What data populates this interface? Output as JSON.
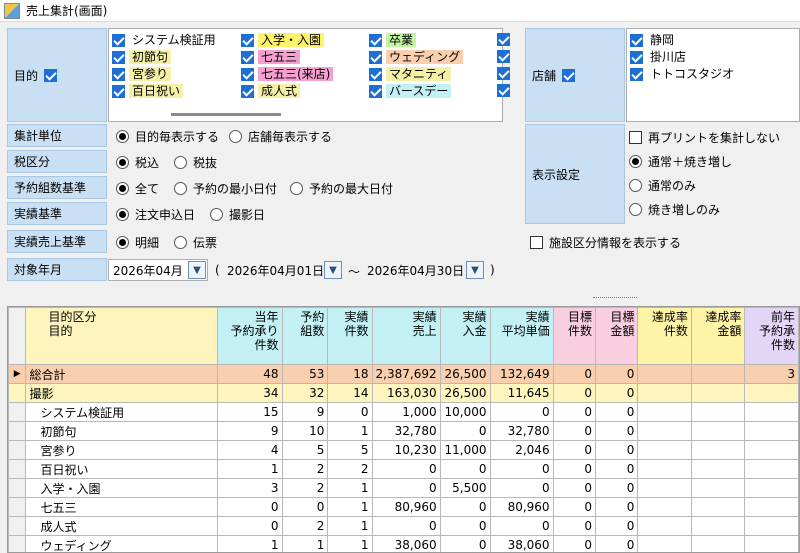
{
  "window": {
    "title": "売上集計(画面)"
  },
  "purpose": {
    "label": "目的",
    "items": [
      {
        "label": "システム検証用",
        "color": "#ffffff"
      },
      {
        "label": "初節句",
        "color": "#f5f0a8"
      },
      {
        "label": "宮参り",
        "color": "#f5f0a8"
      },
      {
        "label": "百日祝い",
        "color": "#f5f0a8"
      },
      {
        "label": "入学・入園",
        "color": "#fff36a"
      },
      {
        "label": "七五三",
        "color": "#f5a0d0"
      },
      {
        "label": "七五三(来店)",
        "color": "#f5a0d0"
      },
      {
        "label": "成人式",
        "color": "#f5f0a8"
      },
      {
        "label": "卒業",
        "color": "#c4f5a0"
      },
      {
        "label": "ウェディング",
        "color": "#f9cfae"
      },
      {
        "label": "マタニティ",
        "color": "#f5f0a8"
      },
      {
        "label": "バースデー",
        "color": "#c2f0f5"
      }
    ]
  },
  "store": {
    "label": "店舗",
    "items": [
      "静岡",
      "掛川店",
      "トトコスタジオ"
    ]
  },
  "agg_unit": {
    "label": "集計単位",
    "options": [
      "目的毎表示する",
      "店舗毎表示する"
    ]
  },
  "tax": {
    "label": "税区分",
    "options": [
      "税込",
      "税抜"
    ]
  },
  "booking_basis": {
    "label": "予約組数基準",
    "options": [
      "全て",
      "予約の最小日付",
      "予約の最大日付"
    ]
  },
  "actual_basis": {
    "label": "実績基準",
    "options": [
      "注文申込日",
      "撮影日"
    ]
  },
  "sales_basis": {
    "label": "実績売上基準",
    "options": [
      "明細",
      "伝票"
    ]
  },
  "target_month": {
    "label": "対象年月",
    "month": "2026年04月",
    "open": "(",
    "from": "2026年04月01日",
    "tilde": "～",
    "to": "2026年04月30日",
    "close": ")"
  },
  "display": {
    "label": "表示設定",
    "reprint": "再プリントを集計しない",
    "opt_all": "通常＋焼き増し",
    "opt_normal": "通常のみ",
    "opt_reprint": "焼き増しのみ",
    "facility": "施設区分情報を表示する"
  },
  "grid": {
    "header_left": [
      "目的区分",
      "目的"
    ],
    "columns": [
      [
        "当年",
        "予約承り",
        "件数"
      ],
      [
        "予約",
        "組数"
      ],
      [
        "実績",
        "件数"
      ],
      [
        "実績",
        "売上"
      ],
      [
        "実績",
        "入金"
      ],
      [
        "実績",
        "平均単価"
      ],
      [
        "目標",
        "件数"
      ],
      [
        "目標",
        "金額"
      ],
      [
        "達成率",
        "件数"
      ],
      [
        "達成率",
        "金額"
      ],
      [
        "前年",
        "予約承",
        "件数"
      ]
    ],
    "header_colors": [
      "#c2f0f5",
      "#c2f0f5",
      "#c2f0f5",
      "#c2f0f5",
      "#c2f0f5",
      "#c2f0f5",
      "#f9cfe0",
      "#f9cfe0",
      "#fff3a8",
      "#fff3a8",
      "#e2d5f5"
    ],
    "rows": [
      {
        "name": "総合計",
        "type": "total",
        "values": [
          "48",
          "53",
          "18",
          "2,387,692",
          "26,500",
          "132,649",
          "0",
          "0",
          "",
          "",
          "3"
        ]
      },
      {
        "name": "撮影",
        "type": "sub",
        "values": [
          "34",
          "32",
          "14",
          "163,030",
          "26,500",
          "11,645",
          "0",
          "0",
          "",
          "",
          ""
        ]
      },
      {
        "name": "システム検証用",
        "type": "item",
        "values": [
          "15",
          "9",
          "0",
          "1,000",
          "10,000",
          "0",
          "0",
          "0",
          "",
          "",
          ""
        ]
      },
      {
        "name": "初節句",
        "type": "item",
        "values": [
          "9",
          "10",
          "1",
          "32,780",
          "0",
          "32,780",
          "0",
          "0",
          "",
          "",
          ""
        ]
      },
      {
        "name": "宮参り",
        "type": "item",
        "values": [
          "4",
          "5",
          "5",
          "10,230",
          "11,000",
          "2,046",
          "0",
          "0",
          "",
          "",
          ""
        ]
      },
      {
        "name": "百日祝い",
        "type": "item",
        "values": [
          "1",
          "2",
          "2",
          "0",
          "0",
          "0",
          "0",
          "0",
          "",
          "",
          ""
        ]
      },
      {
        "name": "入学・入園",
        "type": "item",
        "values": [
          "3",
          "2",
          "1",
          "0",
          "5,500",
          "0",
          "0",
          "0",
          "",
          "",
          ""
        ]
      },
      {
        "name": "七五三",
        "type": "item",
        "values": [
          "0",
          "0",
          "1",
          "80,960",
          "0",
          "80,960",
          "0",
          "0",
          "",
          "",
          ""
        ]
      },
      {
        "name": "成人式",
        "type": "item",
        "values": [
          "0",
          "2",
          "1",
          "0",
          "0",
          "0",
          "0",
          "0",
          "",
          "",
          ""
        ]
      },
      {
        "name": "ウェディング",
        "type": "item",
        "values": [
          "1",
          "1",
          "1",
          "38,060",
          "0",
          "38,060",
          "0",
          "0",
          "",
          "",
          ""
        ]
      }
    ]
  }
}
